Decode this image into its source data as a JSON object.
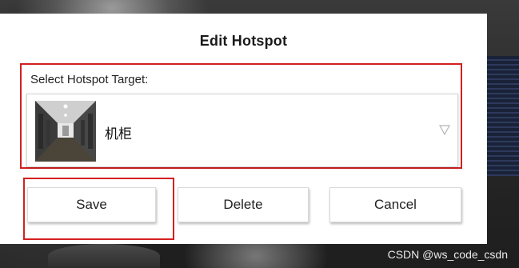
{
  "dialog": {
    "title": "Edit Hotspot",
    "target_label": "Select Hotspot Target:",
    "selected_target": {
      "name": "机柜",
      "thumbnail_icon": "corridor-photo"
    },
    "dropdown_icon": "triangle-down-icon",
    "buttons": {
      "save": "Save",
      "delete": "Delete",
      "cancel": "Cancel"
    }
  },
  "watermark": "CSDN @ws_code_csdn",
  "colors": {
    "highlight_border": "#d42020",
    "dialog_background": "#ffffff"
  }
}
